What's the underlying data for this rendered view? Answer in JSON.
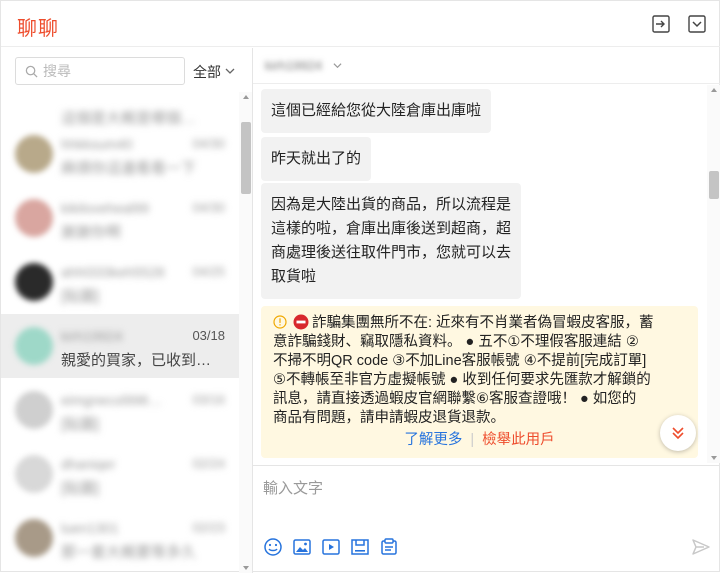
{
  "app": {
    "title": "聊聊"
  },
  "header": {
    "minimize_icon": "minimize-to-tray-icon",
    "collapse_icon": "collapse-icon"
  },
  "sidebar": {
    "search_placeholder": "搜尋",
    "filter_label": "全部",
    "conversations": [
      {
        "name": "",
        "time": "",
        "message": "這個是大概是哪個…"
      },
      {
        "name": "hhkksum40",
        "time": "04/30",
        "message": "麻煩你這邊看看一下"
      },
      {
        "name": "kikiloveheal99",
        "time": "04/30",
        "message": "謝謝你啊"
      },
      {
        "name": "ahhl333keh5528",
        "time": "04/25",
        "message": "[貼圖]"
      },
      {
        "name": "kirh19924",
        "time": "03/18",
        "message": "親愛的買家，已收到…",
        "active": true
      },
      {
        "name": "eimgnecol998…",
        "time": "03/16",
        "message": "[貼圖]"
      },
      {
        "name": "dhaniqer",
        "time": "02/24",
        "message": "[貼圖]"
      },
      {
        "name": "luen1301",
        "time": "02/23",
        "message": "那一套大概要等多久"
      }
    ]
  },
  "chat": {
    "contact_name": "kirh19924",
    "messages": [
      {
        "lines": [
          "這個已經給您從大陸倉庫出庫啦"
        ]
      },
      {
        "lines": [
          "昨天就出了的"
        ]
      },
      {
        "lines": [
          "因為是大陸出貨的商品，所以流程是",
          "這樣的啦，倉庫出庫後送到超商，超",
          "商處理後送往取件門市，您就可以去",
          "取貨啦"
        ]
      }
    ],
    "notice": {
      "lines": [
        "詐騙集團無所不在: 近來有不肖業者偽冒蝦皮客服，蓄",
        "意詐騙錢財、竊取隱私資料。 ● 五不①不理假客服連結 ②",
        "不掃不明QR code ③不加Line客服帳號 ④不提前[完成訂單]",
        "⑤不轉帳至非官方虛擬帳號 ● 收到任何要求先匯款才解鎖的",
        "訊息，請直接透過蝦皮官網聯繫⑥客服查證哦！ ● 如您的",
        "商品有問題，請申請蝦皮退貨退款。"
      ],
      "learn_more": "了解更多",
      "report": "檢舉此用戶"
    },
    "composer_placeholder": "輸入文字"
  },
  "colors": {
    "brand": "#ee4d2d",
    "link": "#2673dd",
    "notice_bg": "#fff8e1"
  }
}
